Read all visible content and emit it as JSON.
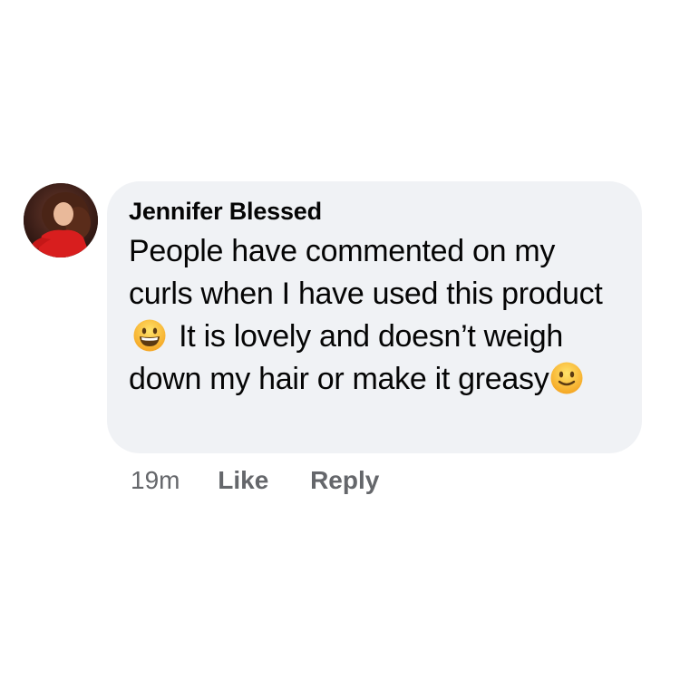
{
  "comment": {
    "author": "Jennifer Blessed",
    "text_part1": "People have commented on my curls when I have used this product",
    "text_part2": "It is lovely and doesn’t weigh down my hair or make it greasy",
    "emoji_1": "grinning-face-icon",
    "emoji_2": "slightly-smiling-face-icon",
    "time": "19m",
    "like_label": "Like",
    "reply_label": "Reply"
  },
  "colors": {
    "bubble_background": "#f0f2f5",
    "action_text": "#65676b",
    "body_text": "#050505"
  }
}
